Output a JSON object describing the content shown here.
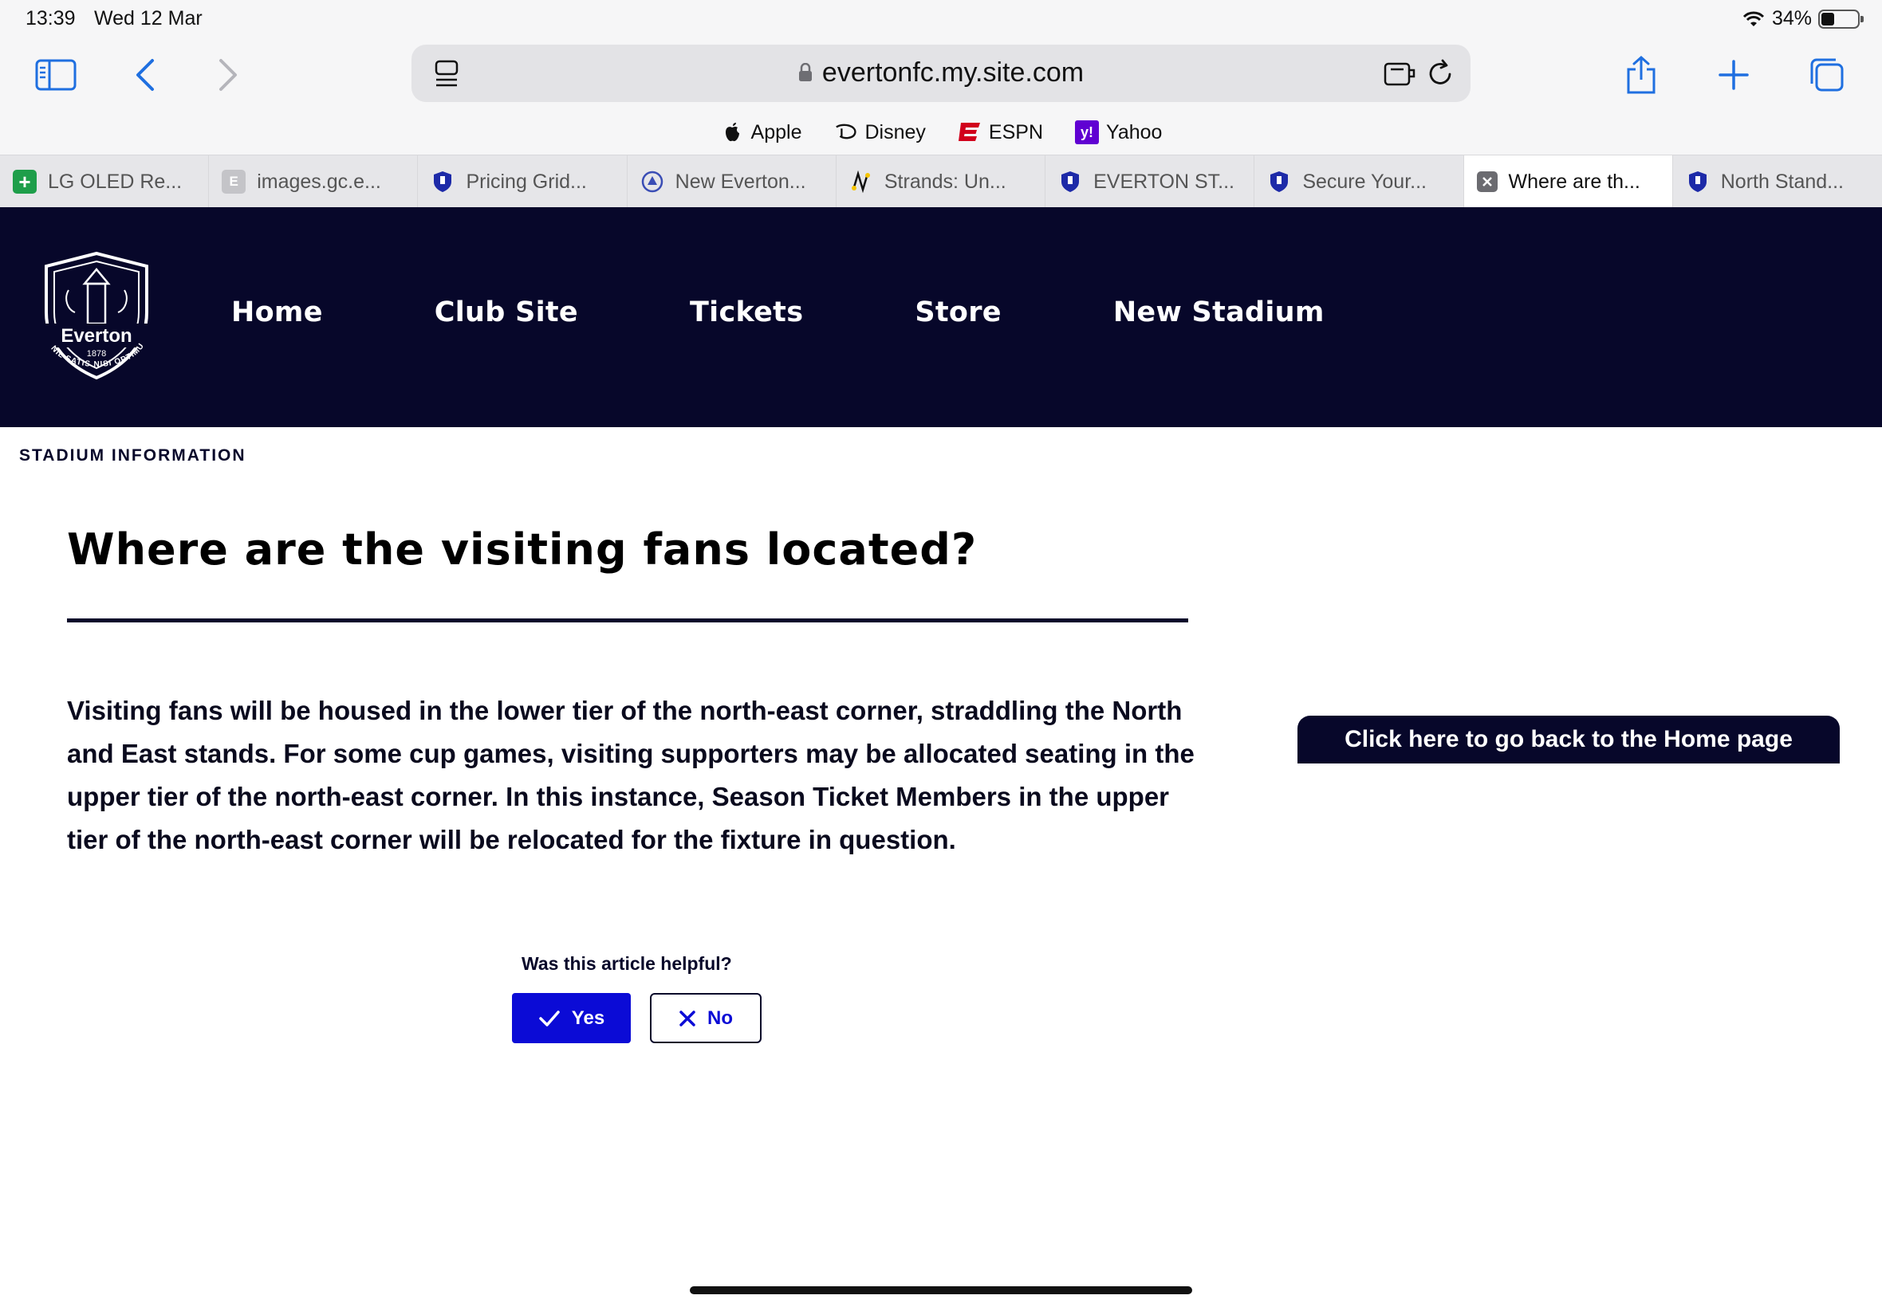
{
  "status_bar": {
    "time": "13:39",
    "date": "Wed 12 Mar",
    "battery": "34%",
    "battery_level": 0.34
  },
  "browser": {
    "url": "evertonfc.my.site.com",
    "favorites": [
      {
        "label": "Apple",
        "icon": "apple-icon"
      },
      {
        "label": "Disney",
        "icon": "disney-icon"
      },
      {
        "label": "ESPN",
        "icon": "espn-icon"
      },
      {
        "label": "Yahoo",
        "icon": "yahoo-icon"
      }
    ],
    "tabs": [
      {
        "label": "LG OLED Re...",
        "icon": "plus-favicon",
        "color": "#1e9e4a"
      },
      {
        "label": "images.gc.e...",
        "icon": "letter-e-favicon",
        "color": "#b8b8bd"
      },
      {
        "label": "Pricing Grid...",
        "icon": "everton-crest-favicon",
        "color": "#1d2aa8"
      },
      {
        "label": "New Everton...",
        "icon": "stadium-crest-favicon",
        "color": "#3a4db5"
      },
      {
        "label": "Strands: Un...",
        "icon": "strands-favicon",
        "color": "#c9a400"
      },
      {
        "label": "EVERTON ST...",
        "icon": "everton-crest-favicon",
        "color": "#1d2aa8"
      },
      {
        "label": "Secure Your...",
        "icon": "everton-crest-favicon",
        "color": "#1d2aa8"
      },
      {
        "label": "Where are th...",
        "icon": "close-icon",
        "color": "#6b6b70",
        "active": true
      },
      {
        "label": "North Stand...",
        "icon": "everton-crest-favicon",
        "color": "#1d2aa8"
      }
    ]
  },
  "site": {
    "logo": {
      "name": "Everton",
      "year": "1878",
      "motto": "NIL SATIS NISI OPTIMUM"
    },
    "nav": [
      "Home",
      "Club Site",
      "Tickets",
      "Store",
      "New Stadium"
    ],
    "breadcrumb": "STADIUM INFORMATION",
    "article": {
      "title": "Where are the visiting fans located?",
      "body": "Visiting fans will be housed in the lower tier of the north-east corner, straddling the North and East stands. For some cup games, visiting supporters may be allocated seating in the upper tier of the north-east corner. In this instance, Season Ticket Members in the upper tier of the north-east corner will be relocated for the fixture in question."
    },
    "home_button": "Click here to go back to the Home page",
    "feedback": {
      "question": "Was this article helpful?",
      "yes": "Yes",
      "no": "No"
    },
    "colors": {
      "navy": "#07072a",
      "accent_blue": "#0b0bd6"
    }
  }
}
